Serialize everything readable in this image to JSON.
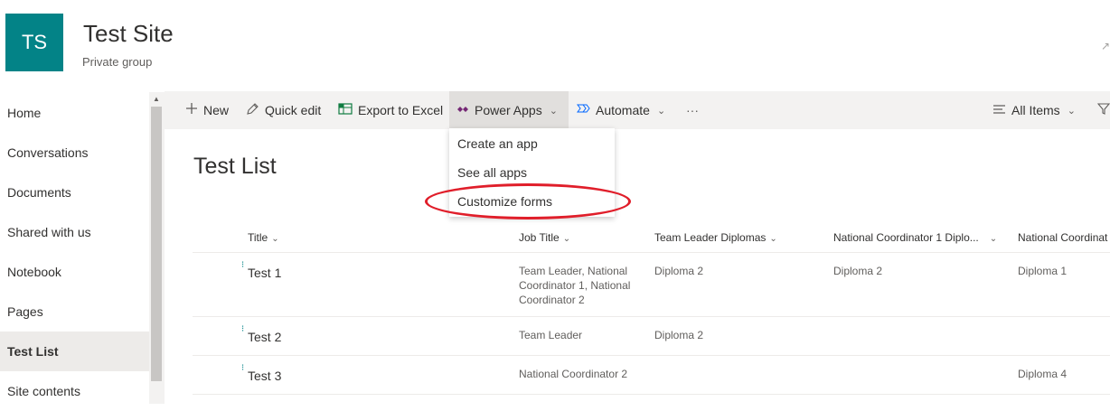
{
  "site": {
    "logo_initials": "TS",
    "title": "Test Site",
    "subtitle": "Private group",
    "edge_glyph": "↗"
  },
  "nav": {
    "items": [
      {
        "label": "Home"
      },
      {
        "label": "Conversations"
      },
      {
        "label": "Documents"
      },
      {
        "label": "Shared with us"
      },
      {
        "label": "Notebook"
      },
      {
        "label": "Pages"
      },
      {
        "label": "Test List",
        "active": true
      },
      {
        "label": "Site contents"
      }
    ]
  },
  "commandbar": {
    "new": "New",
    "quick_edit": "Quick edit",
    "export": "Export to Excel",
    "power_apps": "Power Apps",
    "automate": "Automate",
    "more": "···",
    "view": "All Items"
  },
  "power_apps_menu": {
    "items": [
      "Create an app",
      "See all apps",
      "Customize forms"
    ]
  },
  "list": {
    "title": "Test List",
    "columns": [
      "Title",
      "Job Title",
      "Team Leader Diplomas",
      "National Coordinator 1 Diplo...",
      "National Coordinat"
    ],
    "rows": [
      {
        "title": "Test 1",
        "job": "Team Leader, National Coordinator 1, National Coordinator 2",
        "tl": "Diploma 2",
        "nc1": "Diploma 2",
        "nc2": "Diploma 1"
      },
      {
        "title": "Test 2",
        "job": "Team Leader",
        "tl": "Diploma 2",
        "nc1": "",
        "nc2": ""
      },
      {
        "title": "Test 3",
        "job": "National Coordinator 2",
        "tl": "",
        "nc1": "",
        "nc2": "Diploma 4"
      }
    ]
  },
  "colors": {
    "brand": "#038387",
    "accent": "#0078d4",
    "highlight": "#e01e2a"
  }
}
